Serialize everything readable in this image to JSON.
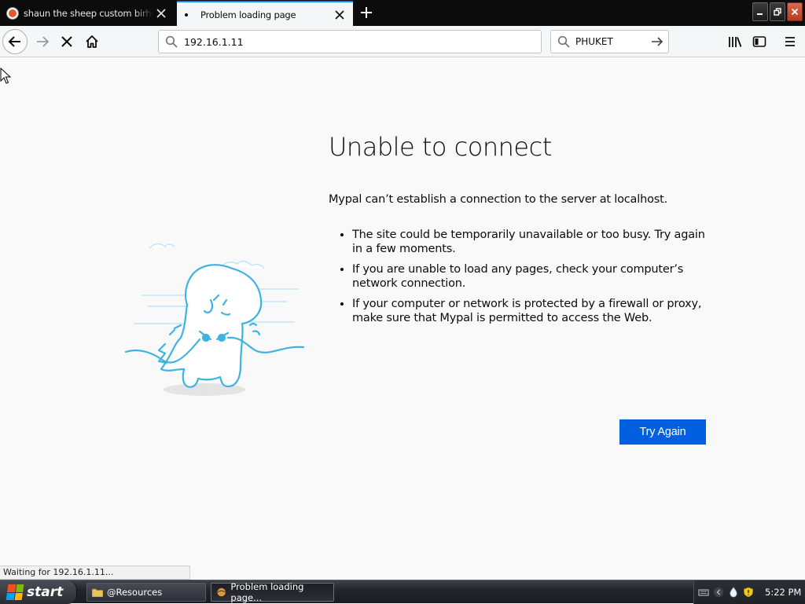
{
  "tabs": [
    {
      "title": "shaun the sheep custom birhday e",
      "active": false
    },
    {
      "title": "Problem loading page",
      "active": true
    }
  ],
  "nav": {
    "url": "192.16.1.11",
    "search_value": "PHUKET"
  },
  "error": {
    "title": "Unable to connect",
    "description": "Mypal can’t establish a connection to the server at localhost.",
    "bullets": [
      "The site could be temporarily unavailable or too busy. Try again in a few moments.",
      "If you are unable to load any pages, check your computer’s network connection.",
      "If your computer or network is protected by a firewall or proxy, make sure that Mypal is permitted to access the Web."
    ],
    "try_again_label": "Try Again"
  },
  "status": "Waiting for 192.16.1.11...",
  "taskbar": {
    "start_label": "start",
    "items": [
      {
        "label": "@Resources",
        "icon": "folder-icon"
      },
      {
        "label": "Problem loading page...",
        "icon": "browser-icon"
      }
    ],
    "clock": "5:22 PM"
  },
  "colors": {
    "accent": "#0060df",
    "tab_highlight": "#0a84ff",
    "illustration": "#3fb3e0"
  }
}
